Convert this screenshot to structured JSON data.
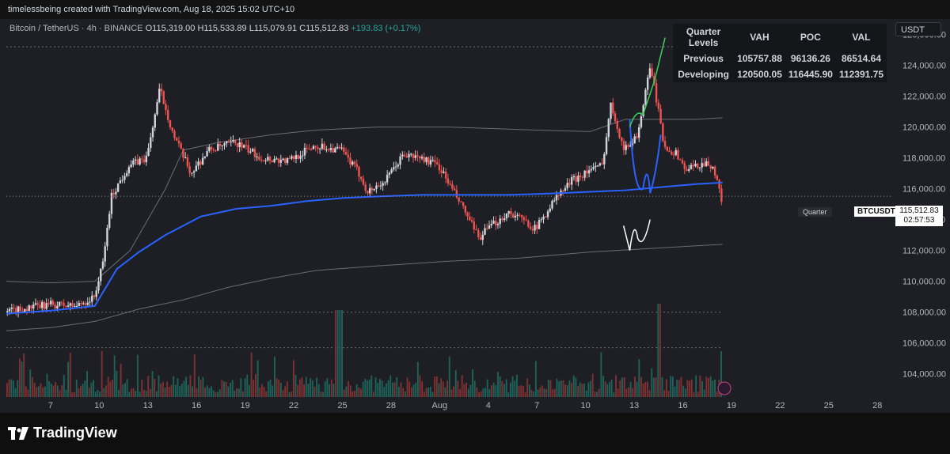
{
  "header": {
    "creator": "timelessbeing created with TradingView.com, Aug 18, 2025 15:02 UTC+10"
  },
  "legend": {
    "symbol": "Bitcoin / TetherUS · 4h · BINANCE",
    "open": "O115,319.00",
    "high": "H115,533.89",
    "low": "L115,079.91",
    "close": "C115,512.83",
    "change": "+193.83 (+0.17%)"
  },
  "table": {
    "headers": [
      "Quarter Levels",
      "VAH",
      "POC",
      "VAL"
    ],
    "rows": [
      [
        "Previous",
        "105757.88",
        "96136.26",
        "86514.64"
      ],
      [
        "Developing",
        "120500.05",
        "116445.90",
        "112391.75"
      ]
    ]
  },
  "currency": "USDT",
  "badges": {
    "quarter": "Quarter",
    "symbol": "BTCUSDT",
    "price": "115,512.83",
    "countdown": "02:57:53"
  },
  "footer": {
    "logo": "TradingView"
  },
  "colors": {
    "up": "#26a69a",
    "down": "#ef5350",
    "ma": "#2962ff",
    "bull_candle": "#d1d4dc",
    "bear_candle": "#ef5350"
  },
  "chart_data": {
    "type": "candlestick",
    "ylim": [
      102500,
      127000
    ],
    "y_ticks": [
      "126,000.00",
      "124,000.00",
      "122,000.00",
      "120,000.00",
      "118,000.00",
      "116,000.00",
      "114,000.00",
      "112,000.00",
      "110,000.00",
      "108,000.00",
      "106,000.00",
      "104,000.00"
    ],
    "x_ticks": [
      {
        "label": "7",
        "pos": 0.05
      },
      {
        "label": "10",
        "pos": 0.105
      },
      {
        "label": "13",
        "pos": 0.16
      },
      {
        "label": "16",
        "pos": 0.215
      },
      {
        "label": "19",
        "pos": 0.27
      },
      {
        "label": "22",
        "pos": 0.325
      },
      {
        "label": "25",
        "pos": 0.38
      },
      {
        "label": "28",
        "pos": 0.435
      },
      {
        "label": "Aug",
        "pos": 0.49
      },
      {
        "label": "4",
        "pos": 0.545
      },
      {
        "label": "7",
        "pos": 0.6
      },
      {
        "label": "10",
        "pos": 0.655
      },
      {
        "label": "13",
        "pos": 0.71
      },
      {
        "label": "16",
        "pos": 0.765
      },
      {
        "label": "19",
        "pos": 0.82
      },
      {
        "label": "22",
        "pos": 0.875
      },
      {
        "label": "25",
        "pos": 0.93
      },
      {
        "label": "28",
        "pos": 0.985
      }
    ],
    "price_path": [
      [
        0,
        108000
      ],
      [
        0.02,
        108200
      ],
      [
        0.05,
        108500
      ],
      [
        0.08,
        108400
      ],
      [
        0.1,
        108900
      ],
      [
        0.11,
        111000
      ],
      [
        0.12,
        115500
      ],
      [
        0.14,
        117500
      ],
      [
        0.16,
        118000
      ],
      [
        0.175,
        122500
      ],
      [
        0.19,
        119500
      ],
      [
        0.21,
        117000
      ],
      [
        0.23,
        118500
      ],
      [
        0.26,
        119000
      ],
      [
        0.29,
        118000
      ],
      [
        0.32,
        117800
      ],
      [
        0.35,
        118800
      ],
      [
        0.38,
        118500
      ],
      [
        0.4,
        117000
      ],
      [
        0.41,
        115800
      ],
      [
        0.43,
        116500
      ],
      [
        0.45,
        118200
      ],
      [
        0.47,
        118000
      ],
      [
        0.49,
        117500
      ],
      [
        0.5,
        116500
      ],
      [
        0.52,
        114500
      ],
      [
        0.535,
        112800
      ],
      [
        0.55,
        113600
      ],
      [
        0.57,
        114500
      ],
      [
        0.59,
        113800
      ],
      [
        0.6,
        113400
      ],
      [
        0.62,
        115200
      ],
      [
        0.64,
        116500
      ],
      [
        0.66,
        117200
      ],
      [
        0.675,
        117500
      ],
      [
        0.685,
        121500
      ],
      [
        0.7,
        118500
      ],
      [
        0.715,
        119500
      ],
      [
        0.73,
        124000
      ],
      [
        0.745,
        118800
      ],
      [
        0.76,
        118200
      ],
      [
        0.77,
        117200
      ],
      [
        0.79,
        117700
      ],
      [
        0.8,
        117500
      ],
      [
        0.81,
        115300
      ]
    ],
    "ma_path": [
      [
        0,
        107900
      ],
      [
        0.05,
        108100
      ],
      [
        0.1,
        108400
      ],
      [
        0.125,
        110800
      ],
      [
        0.15,
        111900
      ],
      [
        0.18,
        113000
      ],
      [
        0.22,
        114200
      ],
      [
        0.26,
        114700
      ],
      [
        0.3,
        114900
      ],
      [
        0.34,
        115200
      ],
      [
        0.38,
        115400
      ],
      [
        0.42,
        115500
      ],
      [
        0.47,
        115600
      ],
      [
        0.52,
        115600
      ],
      [
        0.57,
        115600
      ],
      [
        0.62,
        115700
      ],
      [
        0.66,
        115800
      ],
      [
        0.7,
        115900
      ],
      [
        0.74,
        116100
      ],
      [
        0.78,
        116300
      ],
      [
        0.81,
        116400
      ]
    ],
    "upper_band": [
      [
        0,
        110000
      ],
      [
        0.05,
        109900
      ],
      [
        0.1,
        110000
      ],
      [
        0.14,
        112000
      ],
      [
        0.18,
        116000
      ],
      [
        0.2,
        118500
      ],
      [
        0.24,
        119000
      ],
      [
        0.3,
        119500
      ],
      [
        0.35,
        119800
      ],
      [
        0.42,
        120000
      ],
      [
        0.5,
        120000
      ],
      [
        0.6,
        119800
      ],
      [
        0.66,
        119700
      ],
      [
        0.7,
        120500
      ],
      [
        0.74,
        120500
      ],
      [
        0.78,
        120500
      ],
      [
        0.81,
        120600
      ]
    ],
    "lower_band": [
      [
        0,
        106800
      ],
      [
        0.05,
        107000
      ],
      [
        0.1,
        107400
      ],
      [
        0.15,
        108200
      ],
      [
        0.2,
        108800
      ],
      [
        0.25,
        109600
      ],
      [
        0.3,
        110200
      ],
      [
        0.35,
        110700
      ],
      [
        0.42,
        111000
      ],
      [
        0.5,
        111300
      ],
      [
        0.58,
        111500
      ],
      [
        0.66,
        111900
      ],
      [
        0.72,
        112100
      ],
      [
        0.78,
        112300
      ],
      [
        0.81,
        112400
      ]
    ],
    "dotted_lines": [
      125200,
      108000,
      105700
    ],
    "dashed_price_line": 115512.83,
    "last_price": 115512.83,
    "volume_count": 340
  }
}
